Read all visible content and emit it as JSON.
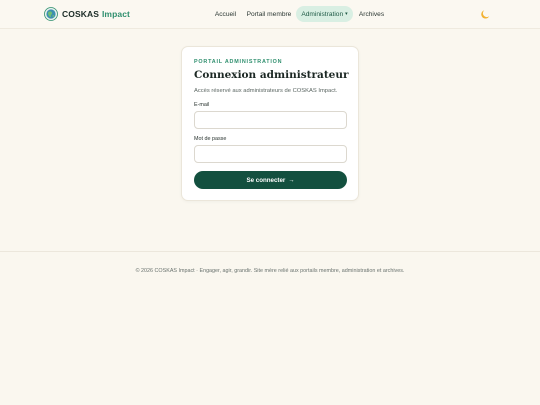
{
  "header": {
    "brand_primary": "COSKAS",
    "brand_secondary": "Impact",
    "nav": [
      {
        "label": "Accueil"
      },
      {
        "label": "Portail membre"
      },
      {
        "label": "Administration",
        "caret": "▾"
      },
      {
        "label": "Archives"
      }
    ],
    "theme_toggle_icon": "moon-icon"
  },
  "login": {
    "kicker": "PORTAIL ADMINISTRATION",
    "title": "Connexion administrateur",
    "subtitle": "Accès réservé aux administrateurs de COSKAS Impact.",
    "email_label": "E-mail",
    "email_value": "",
    "password_label": "Mot de passe",
    "password_value": "",
    "submit_label": "Se connecter",
    "submit_arrow": "→"
  },
  "footer": {
    "text": "© 2026 COSKAS Impact · Engager, agir, grandir. Site mère relié aux portails membre, administration et archives."
  },
  "colors": {
    "accent": "#2f8f6e",
    "button": "#13503f",
    "background": "#faf7ef",
    "nav_active_bg": "#d9efe3"
  }
}
